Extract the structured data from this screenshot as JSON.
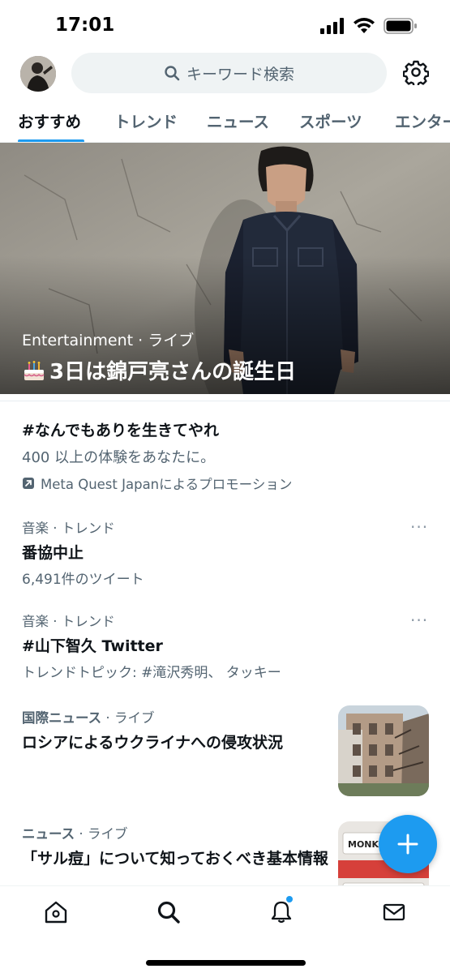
{
  "status_bar": {
    "time": "17:01"
  },
  "header": {
    "search_placeholder": "キーワード検索",
    "icons": {
      "avatar": "user-avatar",
      "search": "search-icon",
      "settings": "gear-icon"
    }
  },
  "tabs": [
    {
      "label": "おすすめ",
      "active": true
    },
    {
      "label": "トレンド",
      "active": false
    },
    {
      "label": "ニュース",
      "active": false
    },
    {
      "label": "スポーツ",
      "active": false
    },
    {
      "label": "エンター",
      "active": false
    }
  ],
  "hero": {
    "category": "Entertainment",
    "separator": " · ",
    "live": "ライブ",
    "emoji": "cake-icon",
    "title": "3日は錦戸亮さんの誕生日"
  },
  "promo": {
    "title": "#なんでもありを生きてやれ",
    "subtitle": "400 以上の体験をあなたに。",
    "promoted_by": "Meta Quest Japanによるプロモーション"
  },
  "trends": [
    {
      "meta": "音楽 · トレンド",
      "title": "番協中止",
      "sub": "6,491件のツイート"
    },
    {
      "meta": "音楽 · トレンド",
      "title": "#山下智久 Twitter",
      "sub": "トレンドトピック: #滝沢秀明、 タッキー"
    }
  ],
  "news": [
    {
      "category": "国際ニュース",
      "separator": " · ",
      "live": "ライブ",
      "title": "ロシアによるウクライナへの侵攻状況"
    },
    {
      "category": "ニュース",
      "separator": " · ",
      "live": "ライブ",
      "title": "「サル痘」について知っておくべき基本情報"
    }
  ],
  "more_icon": "···",
  "thumb_text": "MONKEYPOX",
  "bottom_nav": [
    {
      "name": "home-icon"
    },
    {
      "name": "search-icon"
    },
    {
      "name": "bell-icon"
    },
    {
      "name": "mail-icon"
    }
  ],
  "colors": {
    "accent": "#1d9bf0",
    "text": "#0f1419",
    "secondary": "#536471"
  }
}
